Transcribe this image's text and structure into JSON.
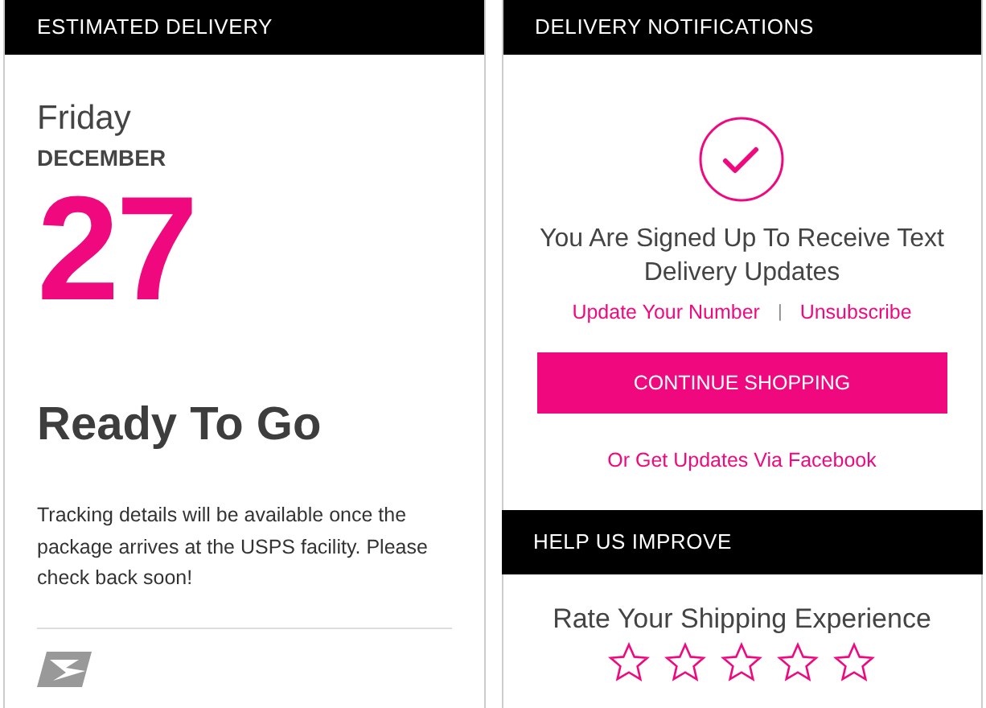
{
  "estimated_delivery": {
    "header": "ESTIMATED DELIVERY",
    "weekday": "Friday",
    "month": "DECEMBER",
    "day": "27",
    "status": "Ready To Go",
    "message": "Tracking details will be available once the package arrives at the USPS facility. Please check back soon!"
  },
  "delivery_notifications": {
    "header": "DELIVERY NOTIFICATIONS",
    "signed_up": true,
    "title": "You Are Signed Up To Receive Text Delivery Updates",
    "links": [
      "Update Your Number",
      "Unsubscribe"
    ],
    "separator": "|",
    "button": "CONTINUE SHOPPING",
    "facebook_link": "Or Get Updates Via Facebook"
  },
  "help_us_improve": {
    "header": "HELP US IMPROVE",
    "prompt": "Rate Your Shipping Experience",
    "stars": 0
  }
}
